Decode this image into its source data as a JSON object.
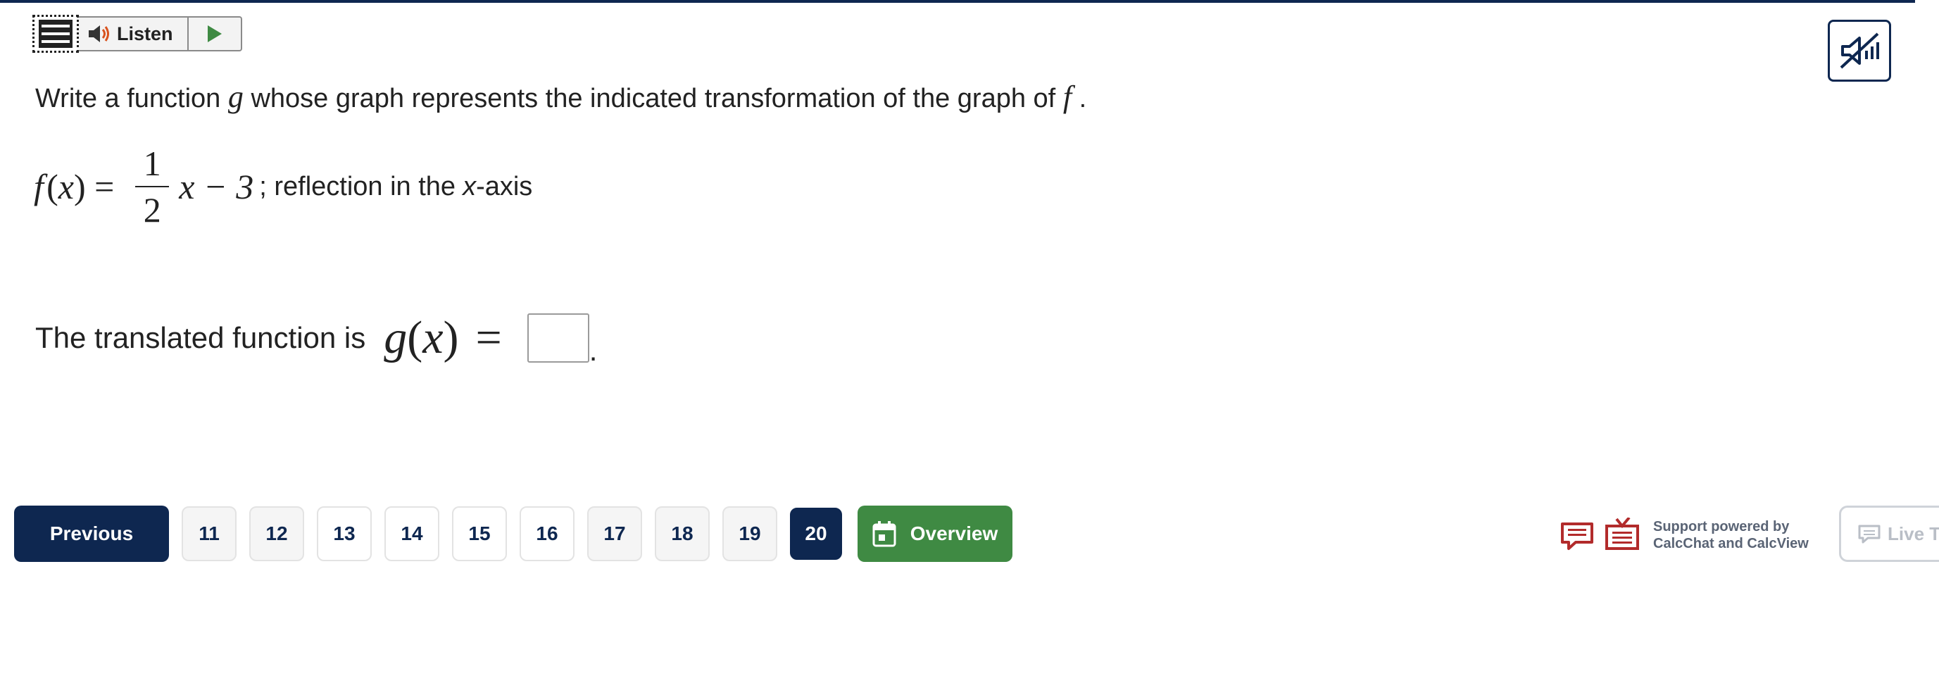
{
  "toolbar": {
    "listen_label": "Listen"
  },
  "question": {
    "prompt_before": "Write a function",
    "prompt_var_g": "g",
    "prompt_middle": "whose graph represents the indicated transformation of the graph of",
    "prompt_var_f": "f",
    "prompt_end": ".",
    "eq_lhs_f": "f",
    "eq_lhs_x": "x",
    "eq_frac_num": "1",
    "eq_frac_den": "2",
    "eq_rhs": "x − 3",
    "eq_tail_before": "; reflection in the",
    "eq_tail_var": "x",
    "eq_tail_after": "-axis"
  },
  "answer": {
    "lead": "The translated function is",
    "g": "g",
    "x": "x",
    "equals": "=",
    "value": "",
    "period": "."
  },
  "nav": {
    "previous_label": "Previous",
    "pages": [
      "11",
      "12",
      "13",
      "14",
      "15",
      "16",
      "17",
      "18",
      "19",
      "20"
    ],
    "current_page": "20",
    "overview_label": "Overview"
  },
  "support": {
    "line1": "Support powered by",
    "line2": "CalcChat and CalcView"
  },
  "live_tutor_label": "Live Tu",
  "colors": {
    "navy": "#0e2750",
    "green": "#3f8a43",
    "support_red": "#b22b2b"
  }
}
